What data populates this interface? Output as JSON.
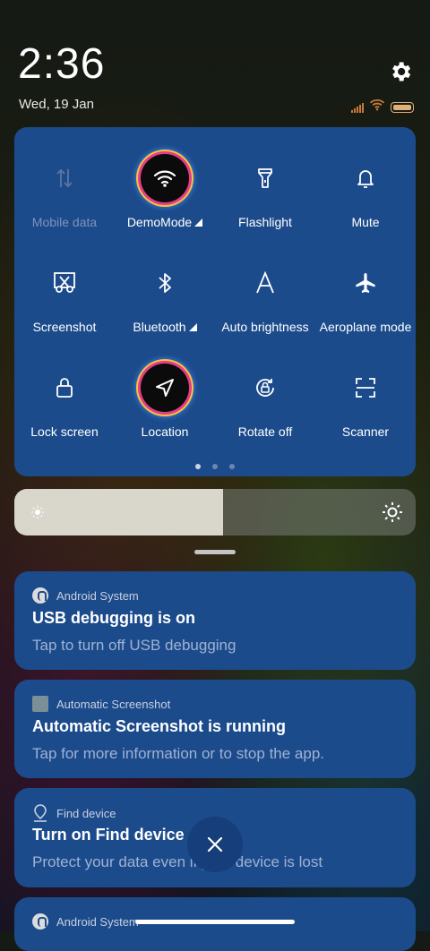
{
  "status_bar": {
    "time": "2:36",
    "date": "Wed, 19 Jan",
    "icons": [
      "signal-icon",
      "wifi-icon",
      "battery-icon"
    ],
    "accent": "#c87a3a"
  },
  "quick_settings": {
    "tiles": [
      {
        "label": "Mobile data",
        "icon": "mobile-data-icon",
        "active": false,
        "disabled": true
      },
      {
        "label": "DemoMode",
        "icon": "wifi-icon",
        "active": true,
        "has_arrow": true
      },
      {
        "label": "Flashlight",
        "icon": "flashlight-icon",
        "active": false
      },
      {
        "label": "Mute",
        "icon": "bell-icon",
        "active": false
      },
      {
        "label": "Screenshot",
        "icon": "scissors-icon",
        "active": false
      },
      {
        "label": "Bluetooth",
        "icon": "bluetooth-icon",
        "active": false,
        "has_arrow": true
      },
      {
        "label": "Auto brightness",
        "icon": "auto-brightness-icon",
        "active": false
      },
      {
        "label": "Aeroplane mode",
        "icon": "airplane-icon",
        "active": false
      },
      {
        "label": "Lock screen",
        "icon": "lock-icon",
        "active": false
      },
      {
        "label": "Location",
        "icon": "location-icon",
        "active": true
      },
      {
        "label": "Rotate off",
        "icon": "rotate-lock-icon",
        "active": false
      },
      {
        "label": "Scanner",
        "icon": "scanner-icon",
        "active": false
      }
    ],
    "page_count": 3,
    "current_page": 1,
    "panel_color": "#1c4b8c"
  },
  "brightness": {
    "level": 0.52
  },
  "notifications": [
    {
      "app": "Android System",
      "icon": "android-system-icon",
      "title": "USB debugging is on",
      "body": "Tap to turn off USB debugging"
    },
    {
      "app": "Automatic Screenshot",
      "icon": "screenshot-app-icon",
      "title": "Automatic Screenshot is running",
      "body": "Tap for more information or to stop the app."
    },
    {
      "app": "Find device",
      "icon": "find-device-icon",
      "title": "Turn on Find device",
      "body": "Protect your data even if your device is lost"
    },
    {
      "app": "Android System",
      "icon": "android-system-icon",
      "title": "",
      "body": ""
    }
  ]
}
